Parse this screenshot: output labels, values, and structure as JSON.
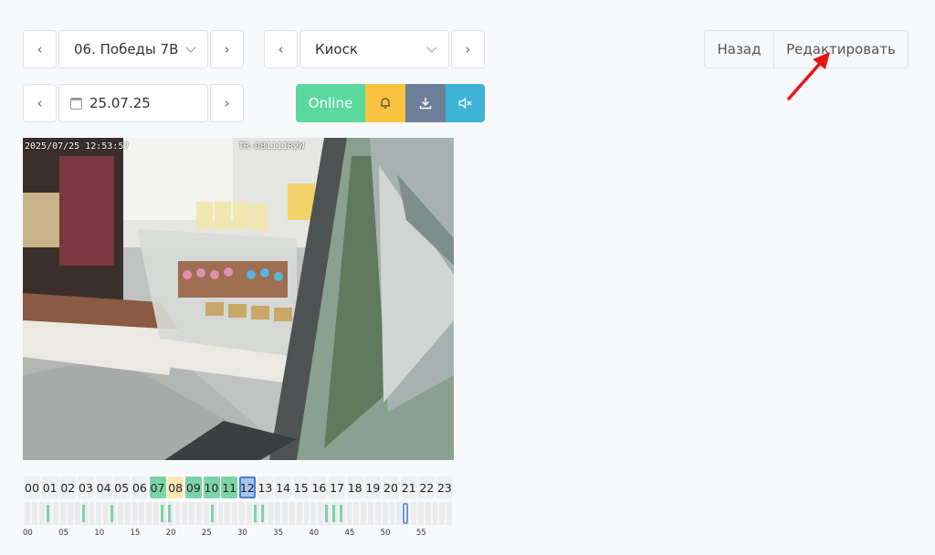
{
  "nav": {
    "location_select": "06. Победы 7В",
    "camera_select": "Киоск",
    "date_value": "25.07.25",
    "prev_icon": "chevron-left",
    "next_icon": "chevron-right"
  },
  "header_actions": {
    "back_label": "Назад",
    "edit_label": "Редактировать"
  },
  "toolbar": {
    "online_label": "Online",
    "online_color": "#5bd89f",
    "bell_color": "#f9c440",
    "download_color": "#6e7f99",
    "mute_color": "#3db3d6",
    "bell_icon": "bell",
    "download_icon": "download",
    "mute_icon": "speaker-mute"
  },
  "camera": {
    "timestamp": "2025/07/25 12:53:57",
    "camera_id": "TR-D8111IR2W"
  },
  "timeline": {
    "hours": [
      "00",
      "01",
      "02",
      "03",
      "04",
      "05",
      "06",
      "07",
      "08",
      "09",
      "10",
      "11",
      "12",
      "13",
      "14",
      "15",
      "16",
      "17",
      "18",
      "19",
      "20",
      "21",
      "22",
      "23"
    ],
    "hours_with_recording_green": [
      "07",
      "09",
      "10",
      "11"
    ],
    "hours_with_recording_yellow": [
      "08"
    ],
    "current_hour": "12",
    "minute_labels": [
      "00",
      "05",
      "10",
      "15",
      "20",
      "25",
      "30",
      "35",
      "40",
      "45",
      "50",
      "55"
    ],
    "minutes_with_events": [
      3,
      8,
      12,
      19,
      20,
      26,
      32,
      33,
      42,
      43,
      44
    ],
    "current_minute": 53
  }
}
